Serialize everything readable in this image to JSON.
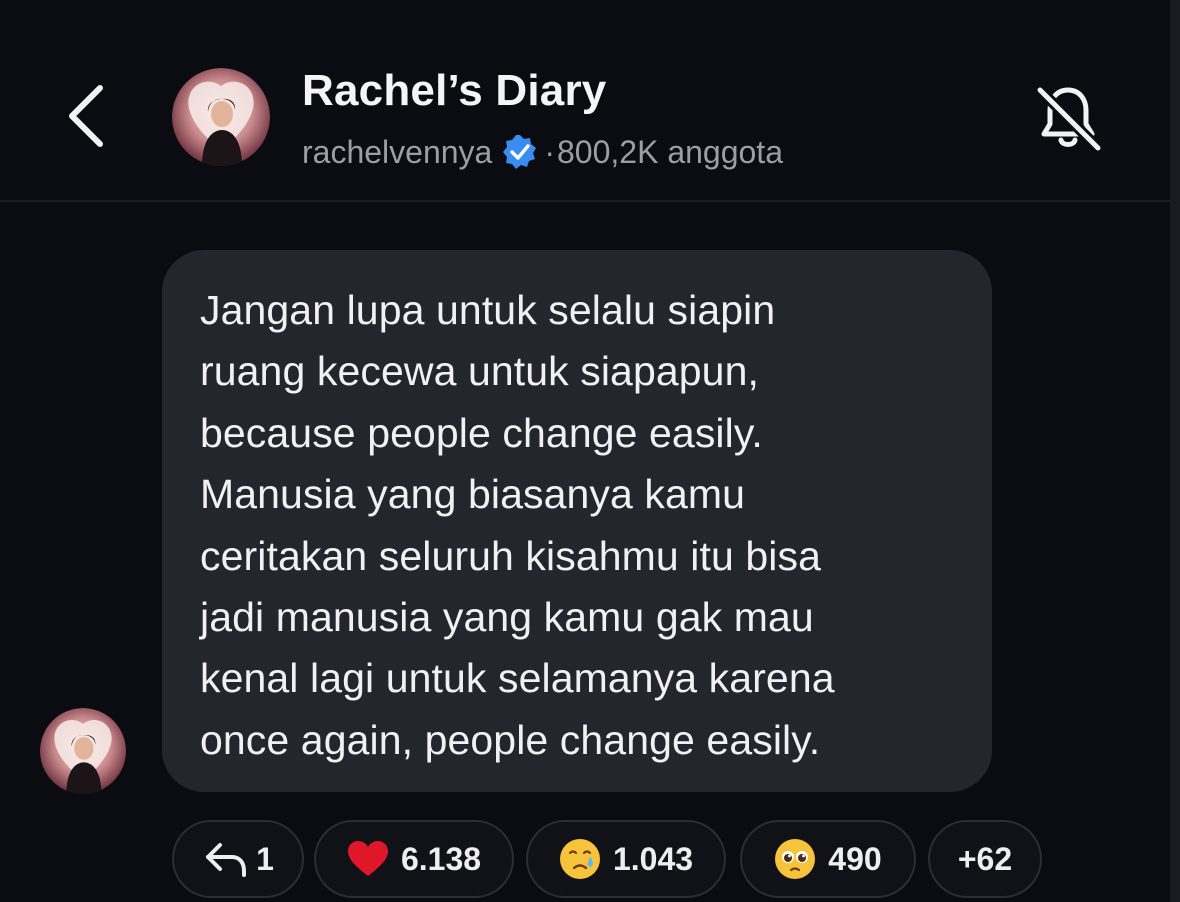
{
  "header": {
    "back_icon": "chevron-left-icon",
    "title": "Rachel’s Diary",
    "handle": "rachelvennya",
    "verified_icon": "verified-badge-icon",
    "separator": "·",
    "members": "800,2K anggota",
    "mute_icon": "bell-off-icon"
  },
  "message": {
    "text": "Jangan lupa untuk selalu siapin\nruang kecewa untuk siapapun,\nbecause people change easily.\nManusia yang biasanya kamu\nceritakan seluruh kisahmu itu bisa\njadi manusia yang kamu gak mau\nkenal lagi untuk selamanya karena\nonce again, people change easily."
  },
  "reactions": {
    "reply": {
      "icon": "reply-icon",
      "count": "1"
    },
    "heart": {
      "icon": "red-heart-icon",
      "count": "6.138"
    },
    "cry": {
      "icon": "crying-face-icon",
      "count": "1.043"
    },
    "plead": {
      "icon": "pleading-face-icon",
      "count": "490"
    },
    "more": {
      "label": "+62"
    }
  },
  "colors": {
    "background": "#0b0c11",
    "bubble": "#24262d",
    "verified": "#3b8cf0",
    "heart": "#e0162b"
  }
}
